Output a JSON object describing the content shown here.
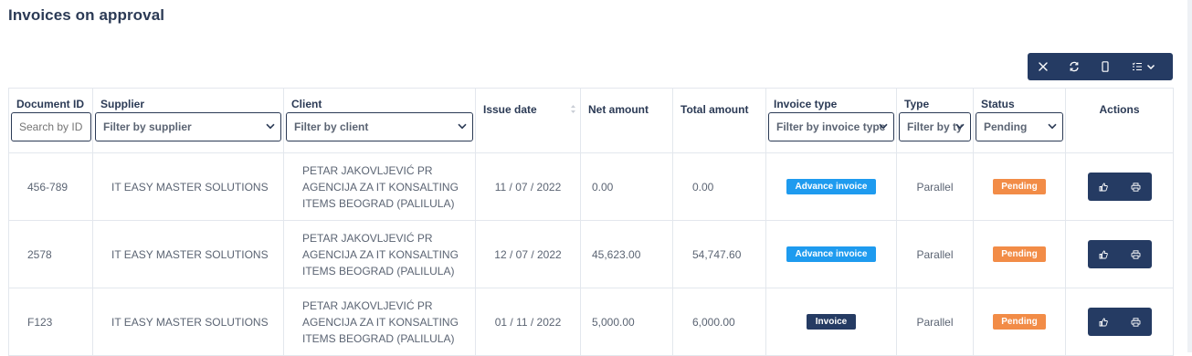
{
  "page": {
    "title": "Invoices on approval"
  },
  "toolbar": {
    "icons": [
      "close-icon",
      "refresh-icon",
      "mobile-view-icon",
      "column-list-icon",
      "chevron-down-icon"
    ]
  },
  "table": {
    "columns": {
      "document_id": "Document ID",
      "supplier": "Supplier",
      "client": "Client",
      "issue_date": "Issue date",
      "net_amount": "Net amount",
      "total_amount": "Total amount",
      "invoice_type": "Invoice type",
      "type": "Type",
      "status": "Status",
      "actions": "Actions"
    },
    "filters": {
      "document_id_placeholder": "Search by ID",
      "supplier": "Filter by supplier",
      "client": "Filter by client",
      "invoice_type": "Filter by invoice type",
      "type": "Filter by type",
      "status": "Pending"
    },
    "rows": [
      {
        "document_id": "456-789",
        "supplier": "IT EASY MASTER SOLUTIONS",
        "client_lines": [
          "PETAR JAKOVLJEVIĆ PR",
          "AGENCIJA ZA IT KONSALTING",
          "ITEMS BEOGRAD (PALILULA)"
        ],
        "issue_date": "11 / 07 / 2022",
        "net_amount": "0.00",
        "total_amount": "0.00",
        "invoice_type": "Advance invoice",
        "type": "Parallel",
        "status": "Pending"
      },
      {
        "document_id": "2578",
        "supplier": "IT EASY MASTER SOLUTIONS",
        "client_lines": [
          "PETAR JAKOVLJEVIĆ PR",
          "AGENCIJA ZA IT KONSALTING",
          "ITEMS BEOGRAD (PALILULA)"
        ],
        "issue_date": "12 / 07 / 2022",
        "net_amount": "45,623.00",
        "total_amount": "54,747.60",
        "invoice_type": "Advance invoice",
        "type": "Parallel",
        "status": "Pending"
      },
      {
        "document_id": "F123",
        "supplier": "IT EASY MASTER SOLUTIONS",
        "client_lines": [
          "PETAR JAKOVLJEVIĆ PR",
          "AGENCIJA ZA IT KONSALTING",
          "ITEMS BEOGRAD (PALILULA)"
        ],
        "issue_date": "01 / 11 / 2022",
        "net_amount": "5,000.00",
        "total_amount": "6,000.00",
        "invoice_type": "Invoice",
        "type": "Parallel",
        "status": "Pending"
      }
    ],
    "row_action_icons": [
      "approve-icon",
      "print-icon"
    ]
  },
  "colors": {
    "primary_navy": "#253b63",
    "advance_badge": "#1e9bef",
    "pending_badge": "#f28c47"
  }
}
